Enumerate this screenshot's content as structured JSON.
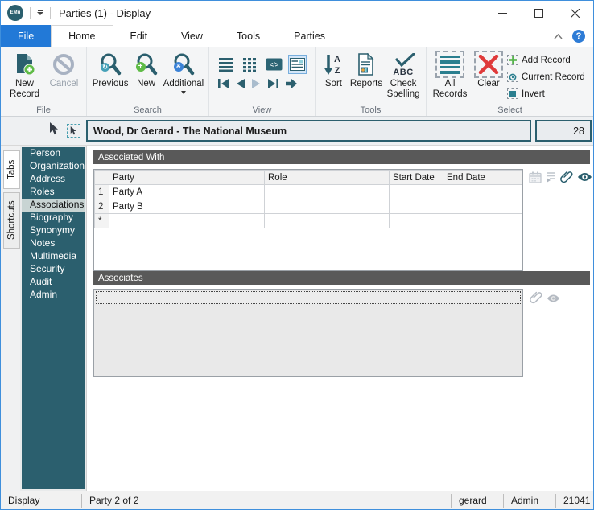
{
  "window": {
    "logo_text": "EMu",
    "title": "Parties (1) - Display"
  },
  "menu": {
    "file": "File",
    "home": "Home",
    "edit": "Edit",
    "view": "View",
    "tools": "Tools",
    "parties": "Parties"
  },
  "ribbon": {
    "file": {
      "label": "File",
      "new_record": "New Record",
      "cancel": "Cancel"
    },
    "search": {
      "label": "Search",
      "previous": "Previous",
      "new": "New",
      "additional": "Additional"
    },
    "view": {
      "label": "View"
    },
    "tools": {
      "label": "Tools",
      "sort": "Sort",
      "reports": "Reports",
      "check_spelling": "Check Spelling"
    },
    "select": {
      "label": "Select",
      "all_records": "All Records",
      "clear": "Clear",
      "add_record": "Add Record",
      "current_record": "Current Record",
      "invert": "Invert"
    }
  },
  "record_header": {
    "summary": "Wood, Dr Gerard - The National Museum",
    "record_number": "28"
  },
  "rail": {
    "tabs": "Tabs",
    "shortcuts": "Shortcuts"
  },
  "sidebar": {
    "selected": "Associations",
    "items": [
      "Person",
      "Organization",
      "Address",
      "Roles",
      "Associations",
      "Biography",
      "Synonymy",
      "Notes",
      "Multimedia",
      "Security",
      "Audit",
      "Admin"
    ]
  },
  "associated_with": {
    "title": "Associated With",
    "columns": {
      "party": "Party",
      "role": "Role",
      "start_date": "Start Date",
      "end_date": "End Date"
    },
    "rows": [
      {
        "num": "1",
        "party": "Party A",
        "role": "",
        "start_date": "",
        "end_date": ""
      },
      {
        "num": "2",
        "party": "Party B",
        "role": "",
        "start_date": "",
        "end_date": ""
      },
      {
        "num": "*",
        "party": "",
        "role": "",
        "start_date": "",
        "end_date": ""
      }
    ]
  },
  "associates": {
    "title": "Associates",
    "field_value": ""
  },
  "status_bar": {
    "mode": "Display",
    "record_position": "Party 2 of 2",
    "user": "gerard",
    "group": "Admin",
    "code": "21041"
  },
  "icons": {
    "help": "?"
  },
  "colors": {
    "teal": "#2b5f6e",
    "accent_blue": "#2279d7",
    "green": "#56b44c",
    "red": "#df3a3a",
    "section_header": "#595959"
  }
}
